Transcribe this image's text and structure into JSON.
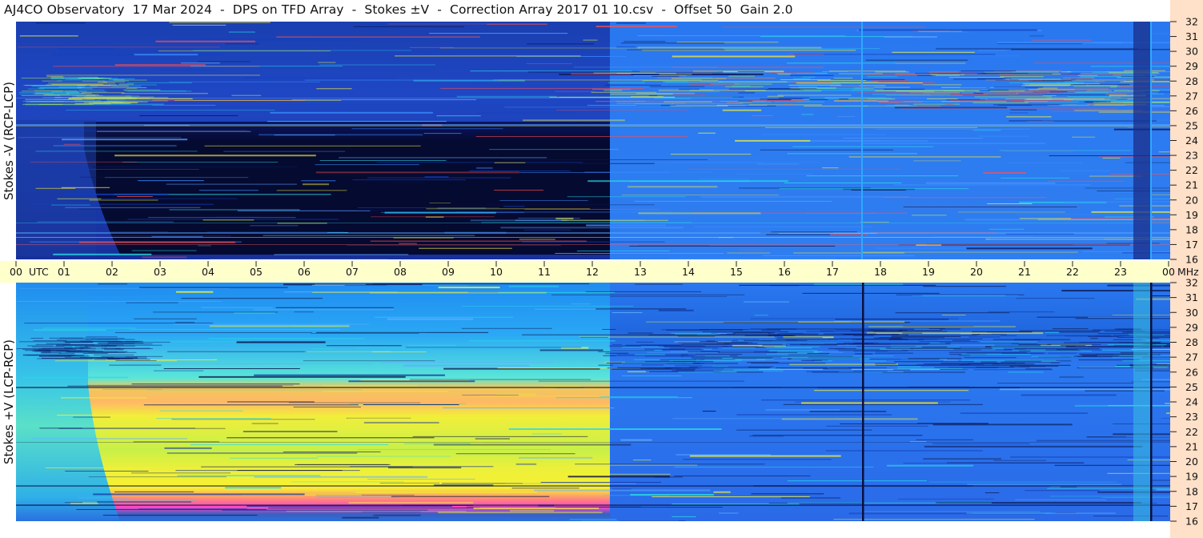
{
  "title": "AJ4CO Observatory  17 Mar 2024  -  DPS on TFD Array  -  Stokes ±V  -  Correction Array 2017 01 10.csv  -  Offset 50  Gain 2.0",
  "colors": {
    "axis_band": "#ffffcc",
    "freq_band": "#ffe0c8",
    "deep_blue": "#0a1a6e",
    "mid_blue": "#2a63e6",
    "light_blue": "#2f8df5",
    "cyan": "#2ad8e6",
    "green_yellow": "#b6f24a",
    "yellow": "#f2f23a",
    "orange": "#ffae5a",
    "magenta": "#ff3fc6"
  },
  "chart_data": {
    "type": "heatmap",
    "panels": [
      {
        "ylabel": "Stokes -V (RCP-LCP)",
        "yticks": [
          "32",
          "31",
          "30",
          "29",
          "28",
          "27",
          "26",
          "25",
          "24",
          "23",
          "22",
          "21",
          "20",
          "19",
          "18",
          "17",
          "16"
        ]
      },
      {
        "ylabel": "Stokes +V (LCP-RCP)",
        "yticks": [
          "32",
          "31",
          "30",
          "29",
          "28",
          "27",
          "26",
          "25",
          "24",
          "23",
          "22",
          "21",
          "20",
          "19",
          "18",
          "17",
          "16"
        ]
      }
    ],
    "ylim": [
      16,
      32
    ],
    "yunit": "MHz",
    "xunit": "UTC",
    "xlim": [
      0,
      24
    ],
    "xticks": [
      "00",
      "01",
      "02",
      "03",
      "04",
      "05",
      "06",
      "07",
      "08",
      "09",
      "10",
      "11",
      "12",
      "13",
      "14",
      "15",
      "16",
      "17",
      "18",
      "19",
      "20",
      "21",
      "22",
      "23",
      "00"
    ],
    "event_times_utc": [
      12.4,
      17.6,
      23.7
    ]
  }
}
